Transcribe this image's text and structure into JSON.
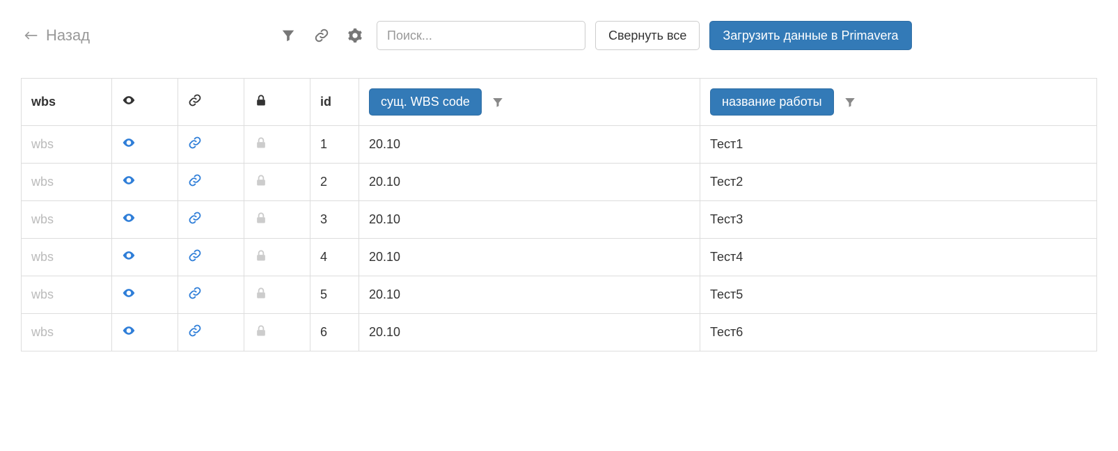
{
  "toolbar": {
    "back_label": "Назад",
    "search_placeholder": "Поиск...",
    "collapse_label": "Свернуть все",
    "load_label": "Загрузить данные в Primavera"
  },
  "table": {
    "headers": {
      "wbs": "wbs",
      "id": "id",
      "wbs_code_btn": "сущ. WBS code",
      "work_name_btn": "название работы"
    },
    "rows": [
      {
        "wbs": "wbs",
        "id": "1",
        "code": "20.10",
        "name": "Тест1"
      },
      {
        "wbs": "wbs",
        "id": "2",
        "code": "20.10",
        "name": "Тест2"
      },
      {
        "wbs": "wbs",
        "id": "3",
        "code": "20.10",
        "name": "Тест3"
      },
      {
        "wbs": "wbs",
        "id": "4",
        "code": "20.10",
        "name": "Тест4"
      },
      {
        "wbs": "wbs",
        "id": "5",
        "code": "20.10",
        "name": "Тест5"
      },
      {
        "wbs": "wbs",
        "id": "6",
        "code": "20.10",
        "name": "Тест6"
      }
    ]
  }
}
